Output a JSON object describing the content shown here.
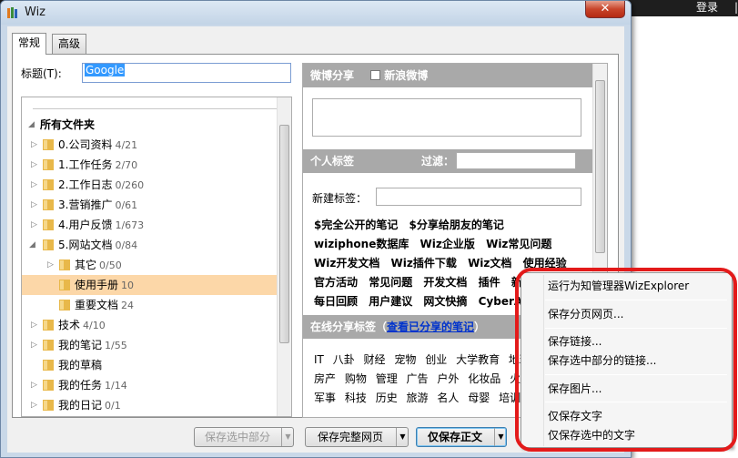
{
  "background_site": {
    "login_label": "登录",
    "logout_label": "|"
  },
  "window": {
    "title": "Wiz",
    "close_label": "✕"
  },
  "tabs": [
    {
      "label": "常规",
      "active": true
    },
    {
      "label": "高级",
      "active": false
    }
  ],
  "form": {
    "title_label": "标题(T):",
    "title_value": "Google"
  },
  "tree": {
    "root": "所有文件夹",
    "items": [
      {
        "name": "0.公司资料",
        "count": "4/21"
      },
      {
        "name": "1.工作任务",
        "count": "2/70"
      },
      {
        "name": "2.工作日志",
        "count": "0/260"
      },
      {
        "name": "3.营销推广",
        "count": "0/61"
      },
      {
        "name": "4.用户反馈",
        "count": "1/673"
      },
      {
        "name": "5.网站文档",
        "count": "0/84"
      },
      {
        "name": "其它",
        "count": "0/50"
      },
      {
        "name": "使用手册",
        "count": "10"
      },
      {
        "name": "重要文档",
        "count": "24"
      },
      {
        "name": "技术",
        "count": "4/10"
      },
      {
        "name": "我的笔记",
        "count": "1/55"
      },
      {
        "name": "我的草稿",
        "count": ""
      },
      {
        "name": "我的任务",
        "count": "1/14"
      },
      {
        "name": "我的日记",
        "count": "0/1"
      }
    ]
  },
  "right_panel": {
    "weibo_head": "微博分享",
    "weibo_option": "新浪微博",
    "tags_head": "个人标签",
    "filter_label": "过滤：",
    "new_tag_label": "新建标签：",
    "tag_rows": [
      [
        "$完全公开的笔记",
        "$分享给朋友的笔记"
      ],
      [
        "wiziphone数据库",
        "Wiz企业版",
        "Wiz常见问题"
      ],
      [
        "Wiz开发文档",
        "Wiz插件下载",
        "Wiz文档",
        "使用经验"
      ],
      [
        "官方活动",
        "常见问题",
        "开发文档",
        "插件",
        "新浪"
      ],
      [
        "每日回顾",
        "用户建议",
        "网文快摘",
        "CyberArt"
      ]
    ],
    "online_head": "在线分享标签（",
    "online_link": "查看已分享的笔记",
    "online_close": "）",
    "common_tag_rows": [
      [
        "IT",
        "八卦",
        "财经",
        "宠物",
        "创业",
        "大学教育",
        "地理"
      ],
      [
        "房产",
        "购物",
        "管理",
        "广告",
        "户外",
        "化妆品",
        "火星人"
      ],
      [
        "军事",
        "科技",
        "历史",
        "旅游",
        "名人",
        "母婴",
        "培训",
        "汽"
      ]
    ]
  },
  "buttons": {
    "save_partial": "保存选中部分",
    "save_full": "保存完整网页",
    "save_main": "仅保存正文",
    "dropdown_arrow": "▼"
  },
  "context_menu": {
    "items": [
      "运行为知管理器WizExplorer",
      "保存分页网页...",
      "保存链接...",
      "保存选中部分的链接...",
      "保存图片...",
      "仅保存文字",
      "仅保存选中的文字"
    ]
  }
}
